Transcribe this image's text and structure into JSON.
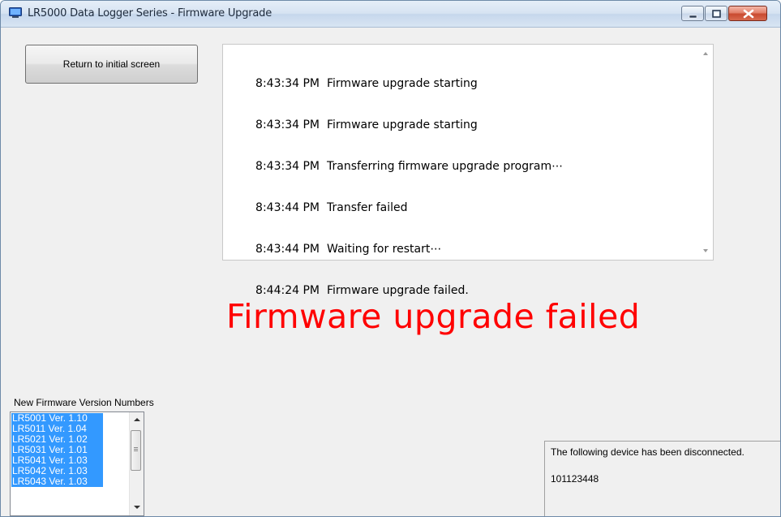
{
  "window": {
    "title": "LR5000 Data Logger Series - Firmware Upgrade"
  },
  "toolbar": {
    "return_label": "Return to initial screen"
  },
  "log": [
    {
      "time": "8:43:34 PM",
      "message": "Firmware upgrade starting"
    },
    {
      "time": "8:43:34 PM",
      "message": "Firmware upgrade starting"
    },
    {
      "time": "8:43:34 PM",
      "message": "Transferring firmware upgrade program⋯"
    },
    {
      "time": "8:43:44 PM",
      "message": "Transfer failed"
    },
    {
      "time": "8:43:44 PM",
      "message": "Waiting for restart⋯"
    },
    {
      "time": "8:44:24 PM",
      "message": "Firmware upgrade failed."
    }
  ],
  "status": {
    "text": "Firmware upgrade failed",
    "color": "#ff0000"
  },
  "firmware": {
    "label": "New Firmware Version Numbers",
    "items": [
      "LR5001 Ver. 1.10",
      "LR5011 Ver. 1.04",
      "LR5021 Ver. 1.02",
      "LR5031 Ver. 1.01",
      "LR5041 Ver. 1.03",
      "LR5042 Ver. 1.03",
      "LR5043 Ver. 1.03"
    ],
    "selection_color": "#3399ff"
  },
  "device": {
    "message": "The following device has been disconnected.",
    "serial": "101123448"
  },
  "icons": {
    "app": "monitor-icon",
    "minimize": "minimize-icon",
    "maximize": "maximize-icon",
    "close": "close-icon"
  }
}
